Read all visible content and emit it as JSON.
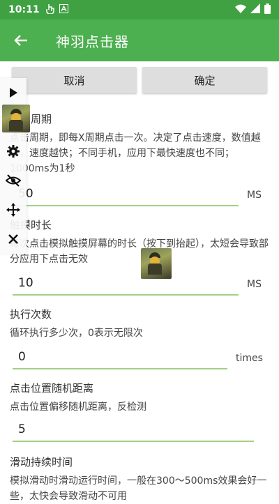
{
  "status_bar": {
    "time": "10:11"
  },
  "app_bar": {
    "title": "神羽点击器"
  },
  "buttons": {
    "cancel": "取消",
    "confirm": "确定"
  },
  "sections": [
    {
      "title": "点击周期",
      "desc": "点击周期，即每X周期点击一次。决定了点击速度，数值越小，速度越快；不同手机，应用下最快速度也不同；1000ms为1秒",
      "value": "50",
      "unit": "MS"
    },
    {
      "title": "触摸时长",
      "desc": "每次点击模拟触摸屏幕的时长（按下到抬起），太短会导致部分应用下点击无效",
      "value": "10",
      "unit": "MS"
    },
    {
      "title": "执行次数",
      "desc": "循环执行多少次，0表示无限次",
      "value": "0",
      "unit": "times"
    },
    {
      "title": "点击位置随机距离",
      "desc": "点击位置偏移随机距离，反检测",
      "value": "5",
      "unit": ""
    },
    {
      "title": "滑动持续时间",
      "desc": "模拟滑动时滑动运行时间，一般在300～500ms效果会好一些，太快会导致滑动不可用"
    }
  ],
  "colors": {
    "app_bar": "#4caf50",
    "status_bar": "#3fa142",
    "underline": "#a4cf86"
  }
}
